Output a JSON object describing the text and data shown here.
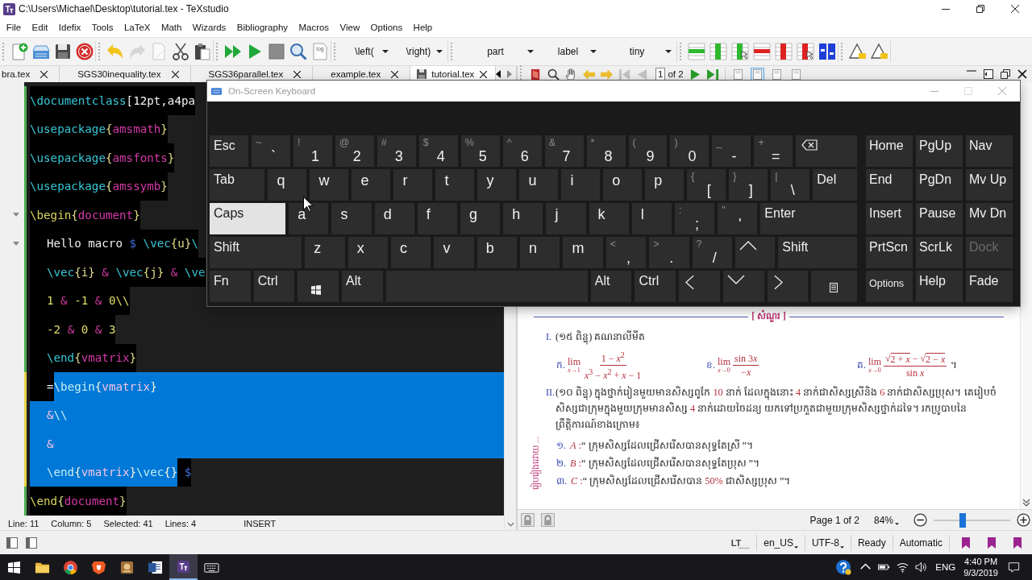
{
  "window": {
    "title": "C:\\Users\\Michael\\Desktop\\tutorial.tex - TeXstudio"
  },
  "menu": [
    "File",
    "Edit",
    "Idefix",
    "Tools",
    "LaTeX",
    "Math",
    "Wizards",
    "Bibliography",
    "Macros",
    "View",
    "Options",
    "Help"
  ],
  "toolbar": [
    [
      {
        "kind": "new",
        "disabled": false
      },
      {
        "kind": "tray",
        "disabled": false
      },
      {
        "kind": "save",
        "disabled": false
      },
      {
        "kind": "close",
        "disabled": false
      }
    ],
    [
      {
        "kind": "undo",
        "disabled": false
      },
      {
        "kind": "redo",
        "disabled": true
      },
      {
        "kind": "copy",
        "disabled": false
      },
      {
        "kind": "cut",
        "disabled": false
      },
      {
        "kind": "paste",
        "disabled": false
      }
    ],
    [
      {
        "kind": "build",
        "disabled": false
      },
      {
        "kind": "run",
        "disabled": false
      },
      {
        "kind": "stop",
        "disabled": false
      },
      {
        "kind": "view",
        "disabled": false
      },
      {
        "kind": "log",
        "label": "log",
        "disabled": false
      }
    ],
    [
      {
        "kind": "dropdown",
        "value": "\\left(",
        "disabled": false
      },
      {
        "kind": "dropdown",
        "value": "\\right)",
        "disabled": false
      }
    ],
    [
      {
        "kind": "dropdown",
        "value": "part",
        "disabled": false
      },
      {
        "kind": "dropdown",
        "value": "label",
        "disabled": false
      },
      {
        "kind": "dropdown",
        "value": "tiny",
        "disabled": false
      }
    ],
    [
      {
        "kind": "row-add",
        "disabled": false
      },
      {
        "kind": "column-add",
        "disabled": false
      },
      {
        "kind": "column-add-cursor",
        "disabled": false
      },
      {
        "kind": "row-remove",
        "disabled": false
      },
      {
        "kind": "column-remove",
        "disabled": false
      },
      {
        "kind": "column-remove-cursor",
        "disabled": false
      },
      {
        "kind": "align",
        "disabled": false
      }
    ],
    [
      {
        "kind": "triangle",
        "disabled": false
      },
      {
        "kind": "triangle",
        "disabled": false
      }
    ]
  ],
  "tabs": [
    {
      "label": "bra.tex",
      "selected": false,
      "modified": false
    },
    {
      "label": "SGS30inequality.tex",
      "selected": false,
      "modified": false
    },
    {
      "label": "SGS36parallel.tex",
      "selected": false,
      "modified": false
    },
    {
      "label": "example.tex",
      "selected": false,
      "modified": false
    },
    {
      "label": "tutorial.tex",
      "selected": true,
      "modified": true
    }
  ],
  "pdf_toolbar": {
    "tools": [
      {
        "kind": "book",
        "disabled": false
      },
      {
        "kind": "search",
        "disabled": false
      },
      {
        "kind": "hand",
        "disabled": false
      },
      {
        "kind": "back",
        "disabled": false
      },
      {
        "kind": "forward",
        "disabled": false
      },
      {
        "kind": "first",
        "disabled": true
      },
      {
        "kind": "previous",
        "disabled": true
      }
    ],
    "page": "1",
    "page_total": "of 2",
    "nav": [
      {
        "kind": "next",
        "disabled": false
      },
      {
        "kind": "last",
        "disabled": false
      }
    ],
    "views": [
      {
        "selected": false
      },
      {
        "selected": true
      },
      {
        "selected": false
      },
      {
        "selected": false
      }
    ]
  },
  "editor": {
    "lines": [
      {
        "indented": false,
        "foldable": false,
        "modified": false,
        "selected_to_end": false,
        "segments": [
          {
            "selected": false,
            "tokens": [
              {
                "text": "\\documentclass",
                "kind": "command"
              },
              {
                "text": "[12pt,a4pa",
                "kind": "text"
              }
            ]
          }
        ]
      },
      {
        "indented": false,
        "foldable": false,
        "modified": false,
        "selected_to_end": false,
        "segments": [
          {
            "selected": false,
            "tokens": [
              {
                "text": "\\usepackage",
                "kind": "command"
              },
              {
                "text": "{",
                "kind": "brace"
              },
              {
                "text": "amsmath",
                "kind": "arg"
              },
              {
                "text": "}",
                "kind": "brace"
              }
            ]
          }
        ]
      },
      {
        "indented": false,
        "foldable": false,
        "modified": false,
        "selected_to_end": false,
        "segments": [
          {
            "selected": false,
            "tokens": [
              {
                "text": "\\usepackage",
                "kind": "command"
              },
              {
                "text": "{",
                "kind": "brace"
              },
              {
                "text": "amsfonts",
                "kind": "arg"
              },
              {
                "text": "}",
                "kind": "brace"
              }
            ]
          }
        ]
      },
      {
        "indented": false,
        "foldable": false,
        "modified": false,
        "selected_to_end": false,
        "segments": [
          {
            "selected": false,
            "tokens": [
              {
                "text": "\\usepackage",
                "kind": "command"
              },
              {
                "text": "{",
                "kind": "brace"
              },
              {
                "text": "amssymb",
                "kind": "arg"
              },
              {
                "text": "}",
                "kind": "brace"
              }
            ]
          }
        ]
      },
      {
        "indented": false,
        "foldable": true,
        "modified": false,
        "selected_to_end": false,
        "segments": [
          {
            "selected": false,
            "tokens": [
              {
                "text": "\\begin",
                "kind": "keyword"
              },
              {
                "text": "{",
                "kind": "brace"
              },
              {
                "text": "document",
                "kind": "arg"
              },
              {
                "text": "}",
                "kind": "brace"
              }
            ]
          }
        ]
      },
      {
        "indented": true,
        "foldable": true,
        "modified": false,
        "selected_to_end": false,
        "segments": [
          {
            "selected": false,
            "tokens": [
              {
                "text": "Hello macro ",
                "kind": "text"
              },
              {
                "text": "$",
                "kind": "math"
              },
              {
                "text": " \\vec",
                "kind": "command"
              },
              {
                "text": "{u}",
                "kind": "brace"
              },
              {
                "text": "\\",
                "kind": "command"
              }
            ]
          }
        ]
      },
      {
        "indented": true,
        "foldable": false,
        "modified": false,
        "selected_to_end": false,
        "segments": [
          {
            "selected": false,
            "tokens": [
              {
                "text": "\\vec",
                "kind": "command"
              },
              {
                "text": "{i}",
                "kind": "brace"
              },
              {
                "text": " &",
                "kind": "amp"
              },
              {
                "text": " \\vec",
                "kind": "command"
              },
              {
                "text": "{j}",
                "kind": "brace"
              },
              {
                "text": " &",
                "kind": "amp"
              },
              {
                "text": " \\ve",
                "kind": "command"
              }
            ]
          }
        ]
      },
      {
        "indented": true,
        "foldable": false,
        "modified": false,
        "selected_to_end": false,
        "segments": [
          {
            "selected": false,
            "tokens": [
              {
                "text": "1",
                "kind": "number"
              },
              {
                "text": " &",
                "kind": "amp"
              },
              {
                "text": " -1",
                "kind": "number"
              },
              {
                "text": " &",
                "kind": "amp"
              },
              {
                "text": " 0",
                "kind": "number"
              },
              {
                "text": "\\\\",
                "kind": "number"
              }
            ]
          }
        ]
      },
      {
        "indented": true,
        "foldable": false,
        "modified": false,
        "selected_to_end": false,
        "segments": [
          {
            "selected": false,
            "tokens": [
              {
                "text": "-2",
                "kind": "number"
              },
              {
                "text": " &",
                "kind": "amp"
              },
              {
                "text": " 0",
                "kind": "number"
              },
              {
                "text": " &",
                "kind": "amp"
              },
              {
                "text": " 3",
                "kind": "number"
              }
            ]
          }
        ]
      },
      {
        "indented": true,
        "foldable": false,
        "modified": false,
        "selected_to_end": false,
        "segments": [
          {
            "selected": false,
            "tokens": [
              {
                "text": "\\end",
                "kind": "command"
              },
              {
                "text": "{",
                "kind": "brace"
              },
              {
                "text": "vmatrix",
                "kind": "arg"
              },
              {
                "text": "}",
                "kind": "brace"
              }
            ]
          }
        ]
      },
      {
        "indented": true,
        "foldable": false,
        "modified": true,
        "selected_to_end": true,
        "segments": [
          {
            "selected": false,
            "tokens": [
              {
                "text": "=",
                "kind": "text"
              }
            ]
          },
          {
            "selected": true,
            "tokens": [
              {
                "text": "\\begin",
                "kind": "command"
              },
              {
                "text": "{",
                "kind": "brace"
              },
              {
                "text": "vmatrix",
                "kind": "arg"
              },
              {
                "text": "}",
                "kind": "brace"
              }
            ]
          }
        ]
      },
      {
        "indented": true,
        "foldable": false,
        "modified": true,
        "selected_to_end": true,
        "segments": [
          {
            "selected": true,
            "tokens": [
              {
                "text": "&",
                "kind": "amp"
              },
              {
                "text": "\\\\",
                "kind": "command"
              }
            ]
          }
        ]
      },
      {
        "indented": true,
        "foldable": false,
        "modified": true,
        "selected_to_end": true,
        "segments": [
          {
            "selected": true,
            "tokens": [
              {
                "text": "&",
                "kind": "amp"
              }
            ]
          }
        ]
      },
      {
        "indented": true,
        "foldable": false,
        "modified": true,
        "selected_to_end": false,
        "segments": [
          {
            "selected": true,
            "tokens": [
              {
                "text": "\\end",
                "kind": "command"
              },
              {
                "text": "{",
                "kind": "brace"
              },
              {
                "text": "vmatrix",
                "kind": "arg"
              },
              {
                "text": "}",
                "kind": "brace"
              },
              {
                "text": "\\vec",
                "kind": "command"
              },
              {
                "text": "{}",
                "kind": "brace"
              }
            ]
          },
          {
            "selected": false,
            "tokens": [
              {
                "text": " $",
                "kind": "math"
              }
            ]
          }
        ]
      },
      {
        "indented": false,
        "foldable": false,
        "modified": false,
        "selected_to_end": false,
        "segments": [
          {
            "selected": false,
            "tokens": [
              {
                "text": "\\end",
                "kind": "keyword"
              },
              {
                "text": "{",
                "kind": "brace"
              },
              {
                "text": "document",
                "kind": "arg"
              },
              {
                "text": "}",
                "kind": "brace"
              }
            ]
          }
        ]
      }
    ],
    "status": [
      "Line: 11",
      "Column: 5",
      "Selected: 41",
      "Lines: 4"
    ],
    "mode": "INSERT"
  },
  "keyboard": {
    "title": "On-Screen Keyboard",
    "rows": [
      {
        "keys": [
          {
            "kind": "text",
            "label": "Esc",
            "pressed": false
          },
          {
            "kind": "dual",
            "shift": "~",
            "label": "`",
            "pressed": false
          },
          {
            "kind": "dual",
            "shift": "!",
            "label": "1",
            "pressed": false
          },
          {
            "kind": "dual",
            "shift": "@",
            "label": "2",
            "pressed": false
          },
          {
            "kind": "dual",
            "shift": "#",
            "label": "3",
            "pressed": false
          },
          {
            "kind": "dual",
            "shift": "$",
            "label": "4",
            "pressed": false
          },
          {
            "kind": "dual",
            "shift": "%",
            "label": "5",
            "pressed": false
          },
          {
            "kind": "dual",
            "shift": "^",
            "label": "6",
            "pressed": false
          },
          {
            "kind": "dual",
            "shift": "&",
            "label": "7",
            "pressed": false
          },
          {
            "kind": "dual",
            "shift": "*",
            "label": "8",
            "pressed": false
          },
          {
            "kind": "dual",
            "shift": "(",
            "label": "9",
            "pressed": false
          },
          {
            "kind": "dual",
            "shift": ")",
            "label": "0",
            "pressed": false
          },
          {
            "kind": "dual",
            "shift": "_",
            "label": "-",
            "pressed": false
          },
          {
            "kind": "dual",
            "shift": "+",
            "label": "=",
            "pressed": false
          },
          {
            "kind": "backspace",
            "pressed": false
          }
        ]
      },
      {
        "keys": [
          {
            "kind": "text",
            "label": "Tab",
            "pressed": false
          },
          {
            "kind": "letter",
            "label": "q",
            "pressed": false
          },
          {
            "kind": "letter",
            "label": "w",
            "pressed": false
          },
          {
            "kind": "letter",
            "label": "e",
            "pressed": false
          },
          {
            "kind": "letter",
            "label": "r",
            "pressed": false
          },
          {
            "kind": "letter",
            "label": "t",
            "pressed": false
          },
          {
            "kind": "letter",
            "label": "y",
            "pressed": false
          },
          {
            "kind": "letter",
            "label": "u",
            "pressed": false
          },
          {
            "kind": "letter",
            "label": "i",
            "pressed": false
          },
          {
            "kind": "letter",
            "label": "o",
            "pressed": false
          },
          {
            "kind": "letter",
            "label": "p",
            "pressed": false
          },
          {
            "kind": "dual",
            "shift": "{",
            "label": "[",
            "pressed": false
          },
          {
            "kind": "dual",
            "shift": "}",
            "label": "]",
            "pressed": false
          },
          {
            "kind": "dual",
            "shift": "|",
            "label": "\\",
            "pressed": false
          },
          {
            "kind": "text",
            "label": "Del",
            "pressed": false
          }
        ]
      },
      {
        "keys": [
          {
            "kind": "text",
            "label": "Caps",
            "pressed": true
          },
          {
            "kind": "letter",
            "label": "a",
            "pressed": false
          },
          {
            "kind": "letter",
            "label": "s",
            "pressed": false
          },
          {
            "kind": "letter",
            "label": "d",
            "pressed": false
          },
          {
            "kind": "letter",
            "label": "f",
            "pressed": false
          },
          {
            "kind": "letter",
            "label": "g",
            "pressed": false
          },
          {
            "kind": "letter",
            "label": "h",
            "pressed": false
          },
          {
            "kind": "letter",
            "label": "j",
            "pressed": false
          },
          {
            "kind": "letter",
            "label": "k",
            "pressed": false
          },
          {
            "kind": "letter",
            "label": "l",
            "pressed": false
          },
          {
            "kind": "dual",
            "shift": ":",
            "label": ";",
            "pressed": false
          },
          {
            "kind": "dual",
            "shift": "\"",
            "label": "'",
            "pressed": false
          },
          {
            "kind": "text",
            "label": "Enter",
            "pressed": false
          }
        ]
      },
      {
        "keys": [
          {
            "kind": "text",
            "label": "Shift",
            "pressed": false
          },
          {
            "kind": "letter",
            "label": "z",
            "pressed": false
          },
          {
            "kind": "letter",
            "label": "x",
            "pressed": false
          },
          {
            "kind": "letter",
            "label": "c",
            "pressed": false
          },
          {
            "kind": "letter",
            "label": "v",
            "pressed": false
          },
          {
            "kind": "letter",
            "label": "b",
            "pressed": false
          },
          {
            "kind": "letter",
            "label": "n",
            "pressed": false
          },
          {
            "kind": "letter",
            "label": "m",
            "pressed": false
          },
          {
            "kind": "dual",
            "shift": "<",
            "label": ",",
            "pressed": false
          },
          {
            "kind": "dual",
            "shift": ">",
            "label": ".",
            "pressed": false
          },
          {
            "kind": "dual",
            "shift": "?",
            "label": "/",
            "pressed": false
          },
          {
            "kind": "up",
            "pressed": false
          },
          {
            "kind": "text",
            "label": "Shift",
            "pressed": false
          }
        ]
      },
      {
        "keys": [
          {
            "kind": "text",
            "label": "Fn",
            "pressed": false
          },
          {
            "kind": "text",
            "label": "Ctrl",
            "pressed": false
          },
          {
            "kind": "windows",
            "pressed": false
          },
          {
            "kind": "text",
            "label": "Alt",
            "pressed": false
          },
          {
            "kind": "space",
            "pressed": false
          },
          {
            "kind": "text",
            "label": "Alt",
            "pressed": false
          },
          {
            "kind": "text",
            "label": "Ctrl",
            "pressed": false
          },
          {
            "kind": "left",
            "pressed": false
          },
          {
            "kind": "down",
            "pressed": false
          },
          {
            "kind": "right",
            "pressed": false
          },
          {
            "kind": "menu",
            "pressed": false
          }
        ]
      }
    ],
    "side": [
      {
        "keys": [
          {
            "label": "Home",
            "disabled": false
          },
          {
            "label": "PgUp",
            "disabled": false
          },
          {
            "label": "Nav",
            "disabled": false
          }
        ]
      },
      {
        "keys": [
          {
            "label": "End",
            "disabled": false
          },
          {
            "label": "PgDn",
            "disabled": false
          },
          {
            "label": "Mv Up",
            "disabled": false
          }
        ]
      },
      {
        "keys": [
          {
            "label": "Insert",
            "disabled": false
          },
          {
            "label": "Pause",
            "disabled": false
          },
          {
            "label": "Mv Dn",
            "disabled": false
          }
        ]
      },
      {
        "keys": [
          {
            "label": "PrtScn",
            "disabled": false
          },
          {
            "label": "ScrLk",
            "disabled": false
          },
          {
            "label": "Dock",
            "disabled": true
          }
        ]
      },
      {
        "keys": [
          {
            "label": "Options",
            "disabled": false
          },
          {
            "label": "Help",
            "disabled": false
          },
          {
            "label": "Fade",
            "disabled": false
          }
        ]
      }
    ]
  },
  "pdf": {
    "side_note": "រៀបរៀងដោយ ...",
    "section_title": "[ សំណួរ ]",
    "questions": [
      {
        "number": "I.",
        "text": [
          {
            "kind": "text",
            "text": "(១៥ ពិន្ទុ) គណនាលីមីត"
          }
        ],
        "limits": [
          {
            "label": "ក.",
            "lim": "lim",
            "under": "*x*→1",
            "numerator": [
              {
                "kind": "text",
                "text": "1 − *x*$^{2}$"
              }
            ],
            "denominator": [
              {
                "kind": "text",
                "text": "*x*$^{3}$ − *x*$^{2}$ + *x* − 1"
              }
            ]
          },
          {
            "label": "ខ.",
            "lim": "lim",
            "under": "*x*→0",
            "numerator": [
              {
                "kind": "text",
                "text": "sin 3"
              },
              {
                "kind": "text",
                "text": "*x*"
              }
            ],
            "denominator": [
              {
                "kind": "text",
                "text": "−*x*"
              }
            ]
          },
          {
            "label": "គ.",
            "lim": "lim",
            "under": "*x*→0",
            "numerator": [
              {
                "kind": "sqrt",
                "sign": "√",
                "text": "2 + *x*"
              },
              {
                "kind": "text",
                "text": " − "
              },
              {
                "kind": "sqrt",
                "sign": "√",
                "text": "2 − *x*"
              }
            ],
            "denominator": [
              {
                "kind": "text",
                "text": "sin *x*"
              }
            ],
            "end": "។"
          }
        ]
      },
      {
        "number": "II.",
        "text": [
          {
            "kind": "text",
            "text": "(១០ ពិន្ទុ) ក្នុងថ្នាក់រៀនមួយមានសិស្សពូកែ "
          },
          {
            "kind": "math",
            "text": "10"
          },
          {
            "kind": "text",
            "text": " នាក់ ដែលក្នុងនោះ "
          },
          {
            "kind": "math",
            "text": "4"
          },
          {
            "kind": "text",
            "text": " នាក់ជាសិស្សស្រីនិង "
          },
          {
            "kind": "math",
            "text": "6"
          },
          {
            "kind": "text",
            "text": " នាក់ជាសិស្សប្រុស។ គេរៀបចំសិស្សជាក្រុមក្នុងមួយក្រុមមានសិស្ស "
          },
          {
            "kind": "math",
            "text": "4"
          },
          {
            "kind": "text",
            "text": " នាក់ដោយចៃដន្យ យកទៅប្រកួតជាមួយក្រុមសិស្សថ្នាក់ដទៃ។ រកប្រូបាបនៃព្រឹត្តិការណ៍ខាងក្រោម៖"
          }
        ],
        "items": [
          {
            "label": "១.",
            "text": [
              {
                "kind": "math",
                "text": "*A* :"
              },
              {
                "kind": "text",
                "text": "“ ក្រុមសិស្សដែលជ្រើសរើសបានសុទ្ធតែស្រី ”។"
              }
            ]
          },
          {
            "label": "២.",
            "text": [
              {
                "kind": "math",
                "text": "*B* :"
              },
              {
                "kind": "text",
                "text": "“ ក្រុមសិស្សដែលជ្រើសរើសបានសុទ្ធតែប្រុស ”។"
              }
            ]
          },
          {
            "label": "៣.",
            "text": [
              {
                "kind": "math",
                "text": "*C* :"
              },
              {
                "kind": "text",
                "text": "“ ក្រុមសិស្សដែលជ្រើសរើសបាន "
              },
              {
                "kind": "math",
                "text": "50%"
              },
              {
                "kind": "text",
                "text": " ជាសិស្សប្រុស ”។"
              }
            ]
          }
        ]
      }
    ]
  },
  "pdf_status": {
    "page": "Page 1 of 2",
    "zoom": "84%",
    "slider": {
      "level": 0.38
    }
  },
  "status_bar": {
    "spell": "LT",
    "language": "en_US",
    "encoding": "UTF-8",
    "state": "Ready",
    "mode": "Automatic"
  },
  "taskbar": {
    "apps": [
      {
        "kind": "folder",
        "selected": false
      },
      {
        "kind": "browser",
        "selected": false
      },
      {
        "kind": "shield",
        "selected": false
      },
      {
        "kind": "app",
        "selected": false
      },
      {
        "kind": "document",
        "selected": false
      },
      {
        "kind": "editor",
        "selected": true
      },
      {
        "kind": "keyboard",
        "selected": false
      }
    ],
    "language": "ENG",
    "time": "4:40 PM",
    "date": "9/3/2019"
  }
}
